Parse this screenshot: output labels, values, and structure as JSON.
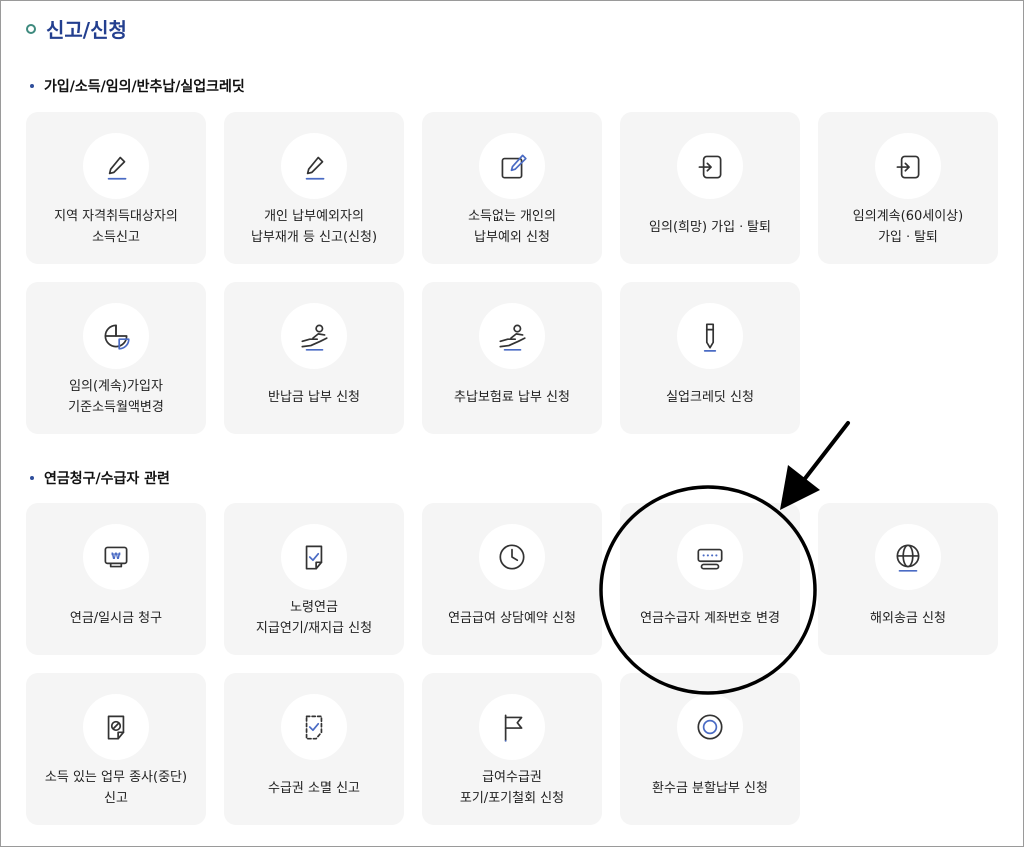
{
  "page": {
    "title": "신고/신청"
  },
  "sections": [
    {
      "title": "가입/소득/임의/반추납/실업크레딧",
      "cards": [
        {
          "label": "지역 자격취득대상자의\n소득신고",
          "icon": "pencil-icon"
        },
        {
          "label": "개인 납부예외자의\n납부재개 등 신고(신청)",
          "icon": "pencil-icon"
        },
        {
          "label": "소득없는 개인의\n납부예외 신청",
          "icon": "edit-box-icon"
        },
        {
          "label": "임의(희망) 가입ㆍ탈퇴",
          "icon": "sign-in-icon"
        },
        {
          "label": "임의계속(60세이상)\n가입ㆍ탈퇴",
          "icon": "sign-in-icon"
        },
        {
          "label": "임의(계속)가입자\n기준소득월액변경",
          "icon": "pie-chart-icon"
        },
        {
          "label": "반납금 납부 신청",
          "icon": "hand-person-icon"
        },
        {
          "label": "추납보험료 납부 신청",
          "icon": "hand-person-icon"
        },
        {
          "label": "실업크레딧 신청",
          "icon": "pen-icon"
        }
      ]
    },
    {
      "title": "연금청구/수급자 관련",
      "cards": [
        {
          "label": "연금/일시금 청구",
          "icon": "won-monitor-icon"
        },
        {
          "label": "노령연금\n지급연기/재지급 신청",
          "icon": "document-check-icon"
        },
        {
          "label": "연금급여 상담예약 신청",
          "icon": "clock-icon"
        },
        {
          "label": "연금수급자 계좌번호 변경",
          "icon": "password-input-icon"
        },
        {
          "label": "해외송금 신청",
          "icon": "globe-icon"
        },
        {
          "label": "소득 있는 업무 종사(중단)\n신고",
          "icon": "document-prohibit-icon"
        },
        {
          "label": "수급권 소멸 신고",
          "icon": "dashed-document-check-icon"
        },
        {
          "label": "급여수급권\n포기/포기철회 신청",
          "icon": "flag-icon"
        },
        {
          "label": "환수금 분할납부 신청",
          "icon": "coin-icon"
        }
      ]
    }
  ]
}
